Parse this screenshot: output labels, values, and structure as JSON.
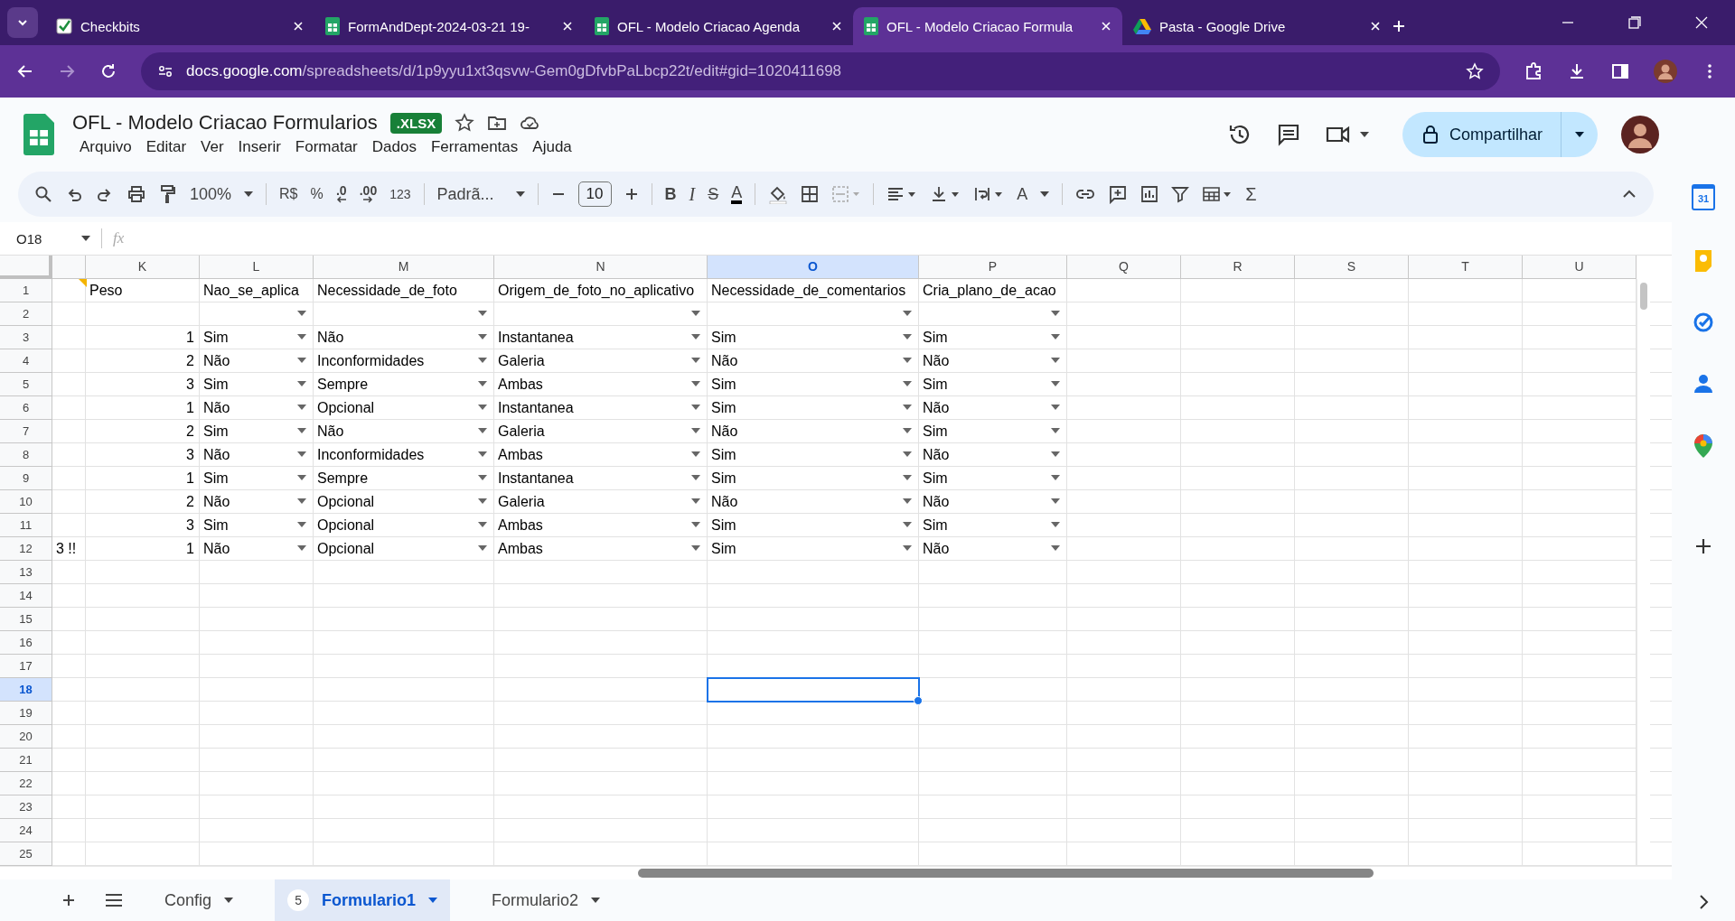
{
  "browser": {
    "tabs": [
      {
        "title": "Checkbits",
        "kind": "check",
        "selected": false
      },
      {
        "title": "FormAndDept-2024-03-21 19-",
        "kind": "sheets",
        "selected": false
      },
      {
        "title": "OFL - Modelo Criacao Agenda",
        "kind": "sheets",
        "selected": false
      },
      {
        "title": "OFL - Modelo Criacao Formula",
        "kind": "sheets",
        "selected": true
      },
      {
        "title": "Pasta - Google Drive",
        "kind": "drive",
        "selected": false
      }
    ],
    "url_host": "docs.google.com",
    "url_path": "/spreadsheets/d/1p9yyu1xt3qsvw-Gem0gDfvbPaLbcp22t/edit#gid=1020411698"
  },
  "document": {
    "title": "OFL - Modelo Criacao Formularios",
    "badge": ".XLSX",
    "menu": [
      "Arquivo",
      "Editar",
      "Ver",
      "Inserir",
      "Formatar",
      "Dados",
      "Ferramentas",
      "Ajuda"
    ],
    "share_label": "Compartilhar"
  },
  "toolbar": {
    "zoom": "100%",
    "currency": "R$",
    "percent": "%",
    "decrease_decimal": ".0",
    "increase_decimal": ".00",
    "number_format": "123",
    "font": "Padrã...",
    "font_size": "10",
    "bold": "B",
    "italic": "I",
    "strikethrough": "S",
    "text_color": "A",
    "text_format": "A",
    "function": "Σ"
  },
  "formula_bar": {
    "cell_ref": "O18",
    "fx": "fx"
  },
  "grid": {
    "columns": [
      {
        "selected": false
      },
      {
        "letter": "K",
        "selected": false
      },
      {
        "letter": "L",
        "selected": false
      },
      {
        "letter": "M",
        "selected": false
      },
      {
        "letter": "N",
        "selected": false
      },
      {
        "letter": "O",
        "selected": true
      },
      {
        "letter": "P",
        "selected": false
      },
      {
        "letter": "Q",
        "selected": false
      },
      {
        "letter": "R",
        "selected": false
      },
      {
        "letter": "S",
        "selected": false
      },
      {
        "letter": "T",
        "selected": false
      },
      {
        "letter": "U",
        "selected": false
      }
    ],
    "rows": [
      {
        "number": "1",
        "selected": false,
        "cells": [
          {
            "note": true
          },
          {
            "text": "Peso"
          },
          {
            "text": "Nao_se_aplica"
          },
          {
            "text": "Necessidade_de_foto"
          },
          {
            "text": "Origem_de_foto_no_aplicativo"
          },
          {
            "text": "Necessidade_de_comentarios"
          },
          {
            "text": "Cria_plano_de_acao"
          }
        ]
      },
      {
        "number": "2",
        "selected": false,
        "cells": [
          null,
          null,
          {
            "dropdown": true
          },
          {
            "dropdown": true
          },
          {
            "dropdown": true
          },
          {
            "dropdown": true
          },
          {
            "dropdown": true
          }
        ]
      },
      {
        "number": "3",
        "selected": false,
        "cells": [
          null,
          {
            "text": "1",
            "kind": "number"
          },
          {
            "text": "Sim",
            "dropdown": true
          },
          {
            "text": "Não",
            "dropdown": true
          },
          {
            "text": "Instantanea",
            "dropdown": true
          },
          {
            "text": "Sim",
            "dropdown": true
          },
          {
            "text": "Sim",
            "dropdown": true
          }
        ]
      },
      {
        "number": "4",
        "selected": false,
        "cells": [
          null,
          {
            "text": "2",
            "kind": "number"
          },
          {
            "text": "Não",
            "dropdown": true
          },
          {
            "text": "Inconformidades",
            "dropdown": true
          },
          {
            "text": "Galeria",
            "dropdown": true
          },
          {
            "text": "Não",
            "dropdown": true
          },
          {
            "text": "Não",
            "dropdown": true
          }
        ]
      },
      {
        "number": "5",
        "selected": false,
        "cells": [
          null,
          {
            "text": "3",
            "kind": "number"
          },
          {
            "text": "Sim",
            "dropdown": true
          },
          {
            "text": "Sempre",
            "dropdown": true
          },
          {
            "text": "Ambas",
            "dropdown": true
          },
          {
            "text": "Sim",
            "dropdown": true
          },
          {
            "text": "Sim",
            "dropdown": true
          }
        ]
      },
      {
        "number": "6",
        "selected": false,
        "cells": [
          null,
          {
            "text": "1",
            "kind": "number"
          },
          {
            "text": "Não",
            "dropdown": true
          },
          {
            "text": "Opcional",
            "dropdown": true
          },
          {
            "text": "Instantanea",
            "dropdown": true
          },
          {
            "text": "Sim",
            "dropdown": true
          },
          {
            "text": "Não",
            "dropdown": true
          }
        ]
      },
      {
        "number": "7",
        "selected": false,
        "cells": [
          null,
          {
            "text": "2",
            "kind": "number"
          },
          {
            "text": "Sim",
            "dropdown": true
          },
          {
            "text": "Não",
            "dropdown": true
          },
          {
            "text": "Galeria",
            "dropdown": true
          },
          {
            "text": "Não",
            "dropdown": true
          },
          {
            "text": "Sim",
            "dropdown": true
          }
        ]
      },
      {
        "number": "8",
        "selected": false,
        "cells": [
          null,
          {
            "text": "3",
            "kind": "number"
          },
          {
            "text": "Não",
            "dropdown": true
          },
          {
            "text": "Inconformidades",
            "dropdown": true
          },
          {
            "text": "Ambas",
            "dropdown": true
          },
          {
            "text": "Sim",
            "dropdown": true
          },
          {
            "text": "Não",
            "dropdown": true
          }
        ]
      },
      {
        "number": "9",
        "selected": false,
        "cells": [
          null,
          {
            "text": "1",
            "kind": "number"
          },
          {
            "text": "Sim",
            "dropdown": true
          },
          {
            "text": "Sempre",
            "dropdown": true
          },
          {
            "text": "Instantanea",
            "dropdown": true
          },
          {
            "text": "Sim",
            "dropdown": true
          },
          {
            "text": "Sim",
            "dropdown": true
          }
        ]
      },
      {
        "number": "10",
        "selected": false,
        "cells": [
          null,
          {
            "text": "2",
            "kind": "number"
          },
          {
            "text": "Não",
            "dropdown": true
          },
          {
            "text": "Opcional",
            "dropdown": true
          },
          {
            "text": "Galeria",
            "dropdown": true
          },
          {
            "text": "Não",
            "dropdown": true
          },
          {
            "text": "Não",
            "dropdown": true
          }
        ]
      },
      {
        "number": "11",
        "selected": false,
        "cells": [
          null,
          {
            "text": "3",
            "kind": "number"
          },
          {
            "text": "Sim",
            "dropdown": true
          },
          {
            "text": "Opcional",
            "dropdown": true
          },
          {
            "text": "Ambas",
            "dropdown": true
          },
          {
            "text": "Sim",
            "dropdown": true
          },
          {
            "text": "Sim",
            "dropdown": true
          }
        ]
      },
      {
        "number": "12",
        "selected": false,
        "cells": [
          {
            "text": "3 !!"
          },
          {
            "text": "1",
            "kind": "number"
          },
          {
            "text": "Não",
            "dropdown": true
          },
          {
            "text": "Opcional",
            "dropdown": true
          },
          {
            "text": "Ambas",
            "dropdown": true
          },
          {
            "text": "Sim",
            "dropdown": true
          },
          {
            "text": "Não",
            "dropdown": true
          }
        ]
      },
      {
        "number": "13",
        "selected": false
      },
      {
        "number": "14",
        "selected": false
      },
      {
        "number": "15",
        "selected": false
      },
      {
        "number": "16",
        "selected": false
      },
      {
        "number": "17",
        "selected": false
      },
      {
        "number": "18",
        "selected": true
      },
      {
        "number": "19",
        "selected": false
      },
      {
        "number": "20",
        "selected": false
      },
      {
        "number": "21",
        "selected": false
      },
      {
        "number": "22",
        "selected": false
      },
      {
        "number": "23",
        "selected": false
      },
      {
        "number": "24",
        "selected": false
      },
      {
        "number": "25",
        "selected": false
      }
    ]
  },
  "sheet_tabs": [
    {
      "name": "Config",
      "selected": false
    },
    {
      "name": "Formulario1",
      "selected": true,
      "badge": "5"
    },
    {
      "name": "Formulario2",
      "selected": false
    }
  ],
  "side_panel": {
    "calendar_day": "31"
  }
}
